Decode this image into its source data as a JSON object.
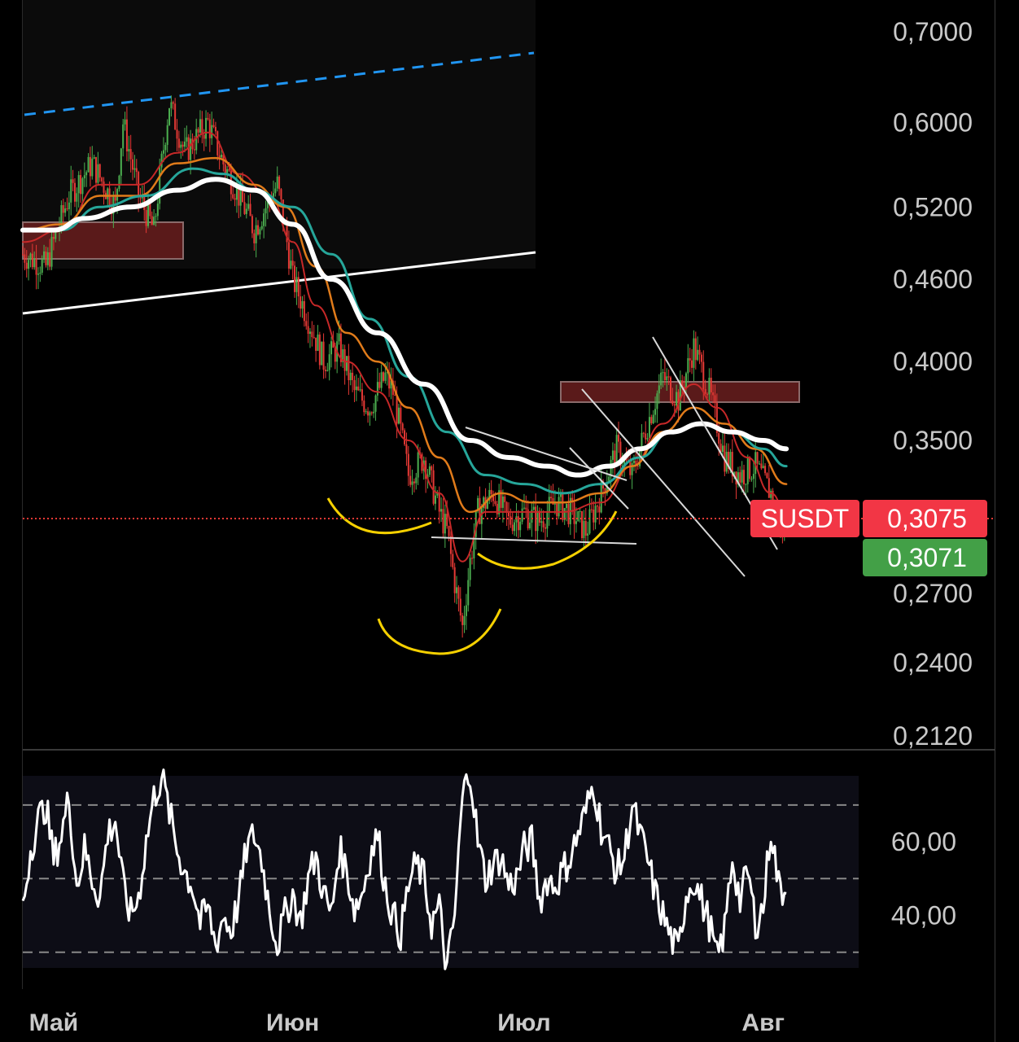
{
  "colors": {
    "background": "#000000",
    "bull": "#4caf50",
    "bear": "#e53935",
    "ma_white": "#ffffff",
    "ma_teal": "#26a69a",
    "ma_orange": "#e07b1a",
    "ma_red": "#c62828",
    "trend_blue": "#2196f3",
    "highlight_yellow": "#f5d000",
    "zone": "#5a1a1a",
    "price_tag": "#f23645",
    "bid_tag": "#43a047"
  },
  "price_tags": {
    "symbol": "SUSDT",
    "last": "0,3075",
    "bid": "0,3071"
  },
  "chart_data": [
    {
      "type": "candlestick",
      "symbol": "SUSDT",
      "yscale": "log",
      "ylim": [
        0.205,
        0.71
      ],
      "y_ticks": [
        {
          "v": 0.7,
          "label": "0,7000"
        },
        {
          "v": 0.6,
          "label": "0,6000"
        },
        {
          "v": 0.52,
          "label": "0,5200"
        },
        {
          "v": 0.46,
          "label": "0,4600"
        },
        {
          "v": 0.4,
          "label": "0,4000"
        },
        {
          "v": 0.35,
          "label": "0,3500"
        },
        {
          "v": 0.27,
          "label": "0,2700"
        },
        {
          "v": 0.24,
          "label": "0,2400"
        },
        {
          "v": 0.212,
          "label": "0,2120"
        }
      ],
      "x_ticks": [
        {
          "day": 4,
          "label": "Май"
        },
        {
          "day": 35,
          "label": "Июн"
        },
        {
          "day": 65,
          "label": "Июл"
        },
        {
          "day": 96,
          "label": "Авг"
        }
      ],
      "xlim": [
        0,
        126
      ],
      "last_price": 0.3075,
      "close_path": [
        [
          0,
          0.48
        ],
        [
          3,
          0.47
        ],
        [
          6,
          0.53
        ],
        [
          9,
          0.56
        ],
        [
          12,
          0.52
        ],
        [
          13,
          0.6
        ],
        [
          15,
          0.53
        ],
        [
          17,
          0.5
        ],
        [
          19,
          0.62
        ],
        [
          21,
          0.57
        ],
        [
          24,
          0.6
        ],
        [
          26,
          0.56
        ],
        [
          28,
          0.53
        ],
        [
          30,
          0.5
        ],
        [
          33,
          0.54
        ],
        [
          35,
          0.46
        ],
        [
          37,
          0.43
        ],
        [
          39,
          0.4
        ],
        [
          41,
          0.41
        ],
        [
          43,
          0.38
        ],
        [
          45,
          0.37
        ],
        [
          47,
          0.39
        ],
        [
          48,
          0.38
        ],
        [
          50,
          0.33
        ],
        [
          52,
          0.34
        ],
        [
          54,
          0.31
        ],
        [
          55,
          0.3
        ],
        [
          56,
          0.275
        ],
        [
          57,
          0.255
        ],
        [
          58,
          0.285
        ],
        [
          59,
          0.31
        ],
        [
          61,
          0.32
        ],
        [
          63,
          0.305
        ],
        [
          65,
          0.31
        ],
        [
          67,
          0.305
        ],
        [
          69,
          0.315
        ],
        [
          71,
          0.31
        ],
        [
          73,
          0.3
        ],
        [
          75,
          0.32
        ],
        [
          77,
          0.345
        ],
        [
          79,
          0.33
        ],
        [
          81,
          0.36
        ],
        [
          83,
          0.39
        ],
        [
          85,
          0.375
        ],
        [
          87,
          0.41
        ],
        [
          89,
          0.38
        ],
        [
          91,
          0.34
        ],
        [
          93,
          0.33
        ],
        [
          95,
          0.335
        ],
        [
          97,
          0.32
        ],
        [
          98,
          0.3
        ],
        [
          99,
          0.3075
        ]
      ],
      "moving_averages": [
        {
          "color": "ma_red",
          "points": [
            [
              0,
              0.49
            ],
            [
              5,
              0.5
            ],
            [
              10,
              0.54
            ],
            [
              15,
              0.54
            ],
            [
              20,
              0.57
            ],
            [
              24,
              0.59
            ],
            [
              28,
              0.55
            ],
            [
              32,
              0.53
            ],
            [
              35,
              0.49
            ],
            [
              38,
              0.44
            ],
            [
              42,
              0.4
            ],
            [
              46,
              0.38
            ],
            [
              50,
              0.35
            ],
            [
              54,
              0.32
            ],
            [
              57,
              0.285
            ],
            [
              60,
              0.31
            ],
            [
              65,
              0.31
            ],
            [
              70,
              0.31
            ],
            [
              75,
              0.315
            ],
            [
              79,
              0.335
            ],
            [
              83,
              0.36
            ],
            [
              87,
              0.385
            ],
            [
              90,
              0.37
            ],
            [
              94,
              0.34
            ],
            [
              97,
              0.32
            ],
            [
              99,
              0.31
            ]
          ]
        },
        {
          "color": "ma_orange",
          "points": [
            [
              0,
              0.5
            ],
            [
              5,
              0.505
            ],
            [
              10,
              0.53
            ],
            [
              15,
              0.53
            ],
            [
              20,
              0.56
            ],
            [
              25,
              0.565
            ],
            [
              30,
              0.54
            ],
            [
              34,
              0.52
            ],
            [
              38,
              0.47
            ],
            [
              42,
              0.42
            ],
            [
              46,
              0.4
            ],
            [
              50,
              0.37
            ],
            [
              54,
              0.34
            ],
            [
              58,
              0.31
            ],
            [
              62,
              0.32
            ],
            [
              66,
              0.315
            ],
            [
              70,
              0.315
            ],
            [
              75,
              0.32
            ],
            [
              79,
              0.335
            ],
            [
              83,
              0.355
            ],
            [
              87,
              0.37
            ],
            [
              91,
              0.36
            ],
            [
              95,
              0.345
            ],
            [
              99,
              0.325
            ]
          ]
        },
        {
          "color": "ma_teal",
          "points": [
            [
              0,
              0.5
            ],
            [
              5,
              0.5
            ],
            [
              10,
              0.52
            ],
            [
              16,
              0.53
            ],
            [
              22,
              0.555
            ],
            [
              26,
              0.55
            ],
            [
              30,
              0.535
            ],
            [
              35,
              0.52
            ],
            [
              40,
              0.48
            ],
            [
              45,
              0.43
            ],
            [
              50,
              0.39
            ],
            [
              55,
              0.355
            ],
            [
              60,
              0.33
            ],
            [
              65,
              0.325
            ],
            [
              70,
              0.32
            ],
            [
              75,
              0.325
            ],
            [
              80,
              0.34
            ],
            [
              84,
              0.355
            ],
            [
              88,
              0.36
            ],
            [
              92,
              0.355
            ],
            [
              96,
              0.345
            ],
            [
              99,
              0.335
            ]
          ]
        },
        {
          "color": "ma_white",
          "points": [
            [
              0,
              0.5
            ],
            [
              4,
              0.5
            ],
            [
              8,
              0.51
            ],
            [
              14,
              0.52
            ],
            [
              20,
              0.535
            ],
            [
              25,
              0.545
            ],
            [
              30,
              0.535
            ],
            [
              35,
              0.505
            ],
            [
              40,
              0.46
            ],
            [
              46,
              0.42
            ],
            [
              52,
              0.385
            ],
            [
              58,
              0.35
            ],
            [
              63,
              0.34
            ],
            [
              68,
              0.335
            ],
            [
              72,
              0.33
            ],
            [
              76,
              0.335
            ],
            [
              80,
              0.345
            ],
            [
              84,
              0.355
            ],
            [
              88,
              0.36
            ],
            [
              92,
              0.355
            ],
            [
              96,
              0.35
            ],
            [
              99,
              0.345
            ]
          ]
        }
      ]
    },
    {
      "type": "line",
      "ylim": [
        20,
        85
      ],
      "y_ticks": [
        {
          "v": 60,
          "label": "60,00"
        },
        {
          "v": 40,
          "label": "40,00"
        }
      ],
      "bands": [
        30,
        50,
        70
      ],
      "x": [
        0,
        1,
        2,
        3,
        4,
        5,
        6,
        7,
        8,
        9,
        10,
        11,
        12,
        13,
        14,
        15,
        16,
        17,
        18,
        19,
        20,
        21,
        22,
        23,
        24,
        25,
        26,
        27,
        28,
        29,
        30,
        31,
        32,
        33,
        34,
        35,
        36,
        37,
        38,
        39,
        40,
        41,
        42,
        43,
        44,
        45,
        46,
        47,
        48,
        49,
        50,
        51,
        52,
        53,
        54,
        55,
        56,
        57,
        58,
        59,
        60,
        61,
        62,
        63,
        64,
        65,
        66,
        67,
        68,
        69,
        70,
        71,
        72,
        73,
        74,
        75,
        76,
        77,
        78,
        79,
        80,
        81,
        82,
        83,
        84,
        85,
        86,
        87,
        88,
        89,
        90,
        91,
        92,
        93,
        94,
        95,
        96,
        97,
        98,
        99
      ],
      "values": [
        42,
        58,
        66,
        70,
        55,
        62,
        72,
        48,
        58,
        50,
        45,
        62,
        66,
        48,
        40,
        45,
        60,
        72,
        78,
        68,
        58,
        52,
        48,
        38,
        42,
        32,
        40,
        36,
        44,
        58,
        62,
        55,
        42,
        32,
        40,
        46,
        38,
        50,
        56,
        46,
        40,
        58,
        52,
        42,
        46,
        56,
        62,
        48,
        40,
        35,
        48,
        54,
        50,
        38,
        42,
        25,
        40,
        72,
        80,
        60,
        50,
        54,
        56,
        48,
        50,
        58,
        60,
        44,
        50,
        48,
        52,
        56,
        62,
        68,
        76,
        64,
        58,
        52,
        56,
        70,
        62,
        55,
        46,
        40,
        34,
        30,
        46,
        50,
        44,
        38,
        28,
        36,
        56,
        44,
        52,
        38,
        42,
        64,
        48,
        46
      ]
    }
  ]
}
